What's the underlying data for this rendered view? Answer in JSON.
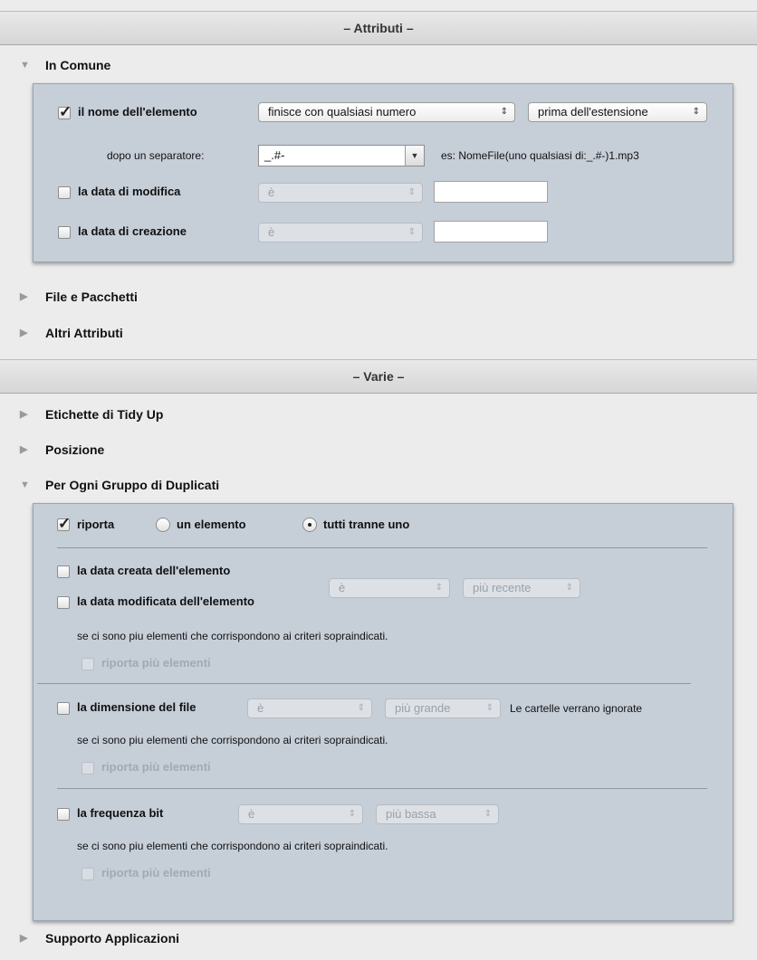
{
  "sections": {
    "attributi": "– Attributi –",
    "varie": "– Varie –"
  },
  "in_comune": {
    "title": "In Comune",
    "nome_elemento": {
      "label": "il nome dell'elemento",
      "checked": true,
      "popup1": "finisce con qualsiasi numero",
      "popup2": "prima dell'estensione"
    },
    "separatore": {
      "label": "dopo un separatore:",
      "value": "_.#-",
      "example": "es: NomeFile(uno qualsiasi di:_.#-)1.mp3"
    },
    "data_modifica": {
      "label": "la data di modifica",
      "popup": "è",
      "value": ""
    },
    "data_creazione": {
      "label": "la data di creazione",
      "popup": "è",
      "value": ""
    }
  },
  "collapsed": {
    "file_pacchetti": "File e Pacchetti",
    "altri_attributi": "Altri Attributi",
    "etichette": "Etichette di Tidy Up",
    "posizione": "Posizione",
    "supporto": "Supporto Applicazioni"
  },
  "duplicati": {
    "title": "Per Ogni Gruppo di Duplicati",
    "riporta": "riporta",
    "radio_un": "un elemento",
    "radio_tutti": "tutti tranne uno",
    "data_creata": "la data creata dell'elemento",
    "data_modificata": "la data modificata dell'elemento",
    "popup_e": "è",
    "popup_recente": "più recente",
    "criteri_note": "se ci sono piu elementi che corrispondono ai criteri sopraindicati.",
    "riporta_piu": "riporta più elementi",
    "dimensione": "la dimensione del file",
    "popup_grande": "più grande",
    "cartelle_note": "Le cartelle verrano ignorate",
    "frequenza": "la frequenza bit",
    "popup_bassa": "più bassa"
  },
  "icons": {
    "expanded": "▼",
    "collapsed": "▶",
    "popup_arrows": "⇕"
  }
}
